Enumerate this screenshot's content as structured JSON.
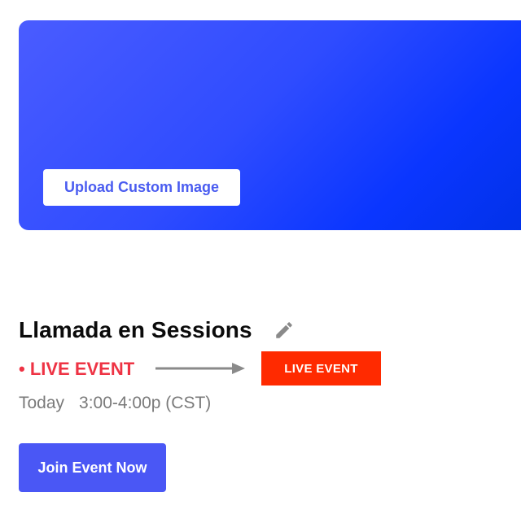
{
  "hero": {
    "upload_button_label": "Upload Custom Image"
  },
  "event": {
    "title": "Llamada en Sessions",
    "live_label": "• LIVE EVENT",
    "live_badge_label": "LIVE EVENT",
    "day": "Today",
    "time": "3:00-4:00p (CST)",
    "join_button_label": "Join Event Now"
  },
  "icons": {
    "edit": "pencil-icon",
    "arrow": "arrow-right-icon"
  },
  "colors": {
    "hero_gradient_start": "#4a5cff",
    "hero_gradient_end": "#0031e6",
    "live_text": "#ee3344",
    "live_badge": "#ff2a00",
    "join_button": "#4a57f5",
    "upload_text": "#4a5cf0"
  }
}
